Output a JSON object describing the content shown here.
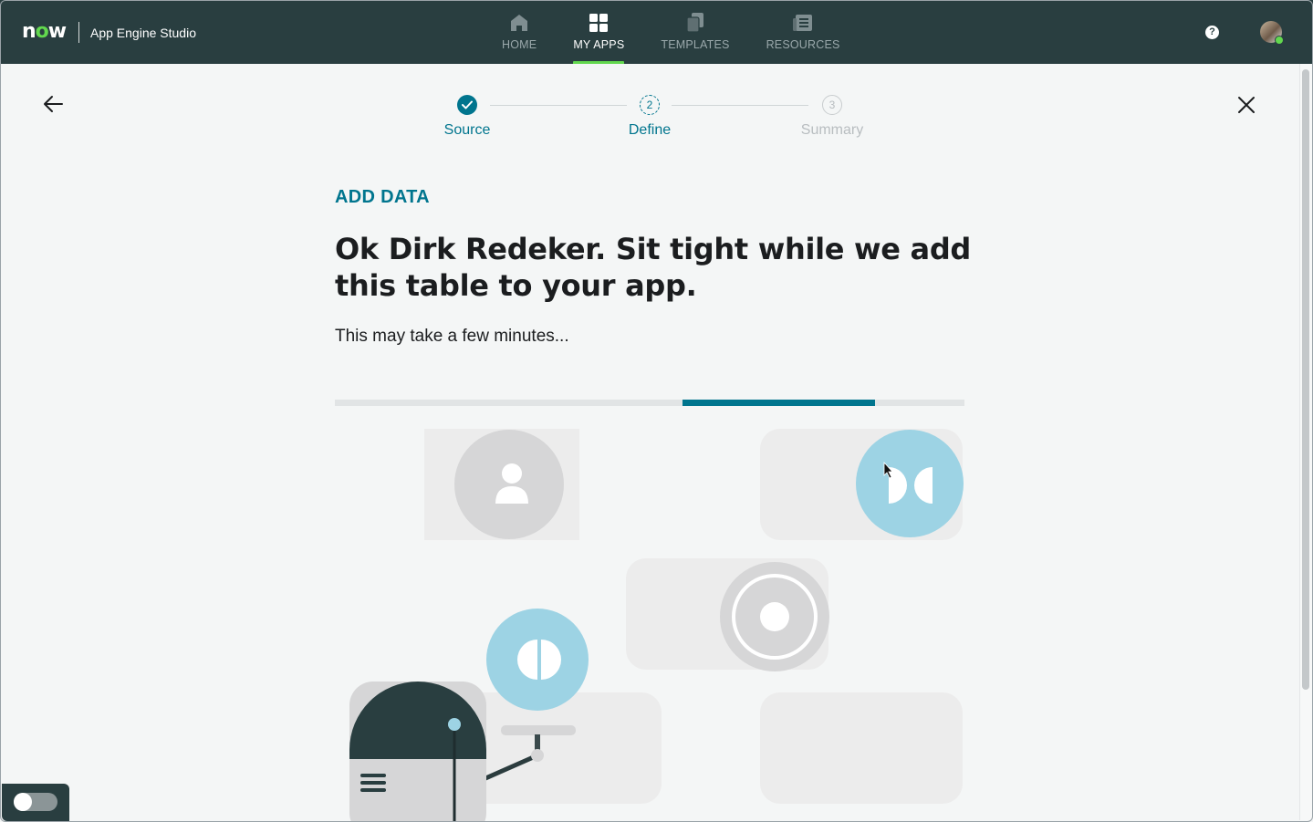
{
  "header": {
    "logo_text": "now",
    "app_title": "App Engine Studio",
    "nav": [
      {
        "label": "HOME",
        "icon": "home-icon",
        "active": false
      },
      {
        "label": "MY APPS",
        "icon": "grid-icon",
        "active": true
      },
      {
        "label": "TEMPLATES",
        "icon": "templates-icon",
        "active": false
      },
      {
        "label": "RESOURCES",
        "icon": "resources-icon",
        "active": false
      }
    ],
    "help_label": "?",
    "colors": {
      "bar": "#293e40",
      "accent": "#62d84e"
    }
  },
  "stepper": {
    "steps": [
      {
        "number": "1",
        "label": "Source",
        "state": "complete"
      },
      {
        "number": "2",
        "label": "Define",
        "state": "current"
      },
      {
        "number": "3",
        "label": "Summary",
        "state": "upcoming"
      }
    ],
    "accent": "#00758e"
  },
  "content": {
    "eyebrow": "ADD DATA",
    "headline": "Ok Dirk Redeker. Sit tight while we add this table to your app.",
    "subtext": "This may take a few minutes...",
    "progress": {
      "start_fraction": 0.552,
      "end_fraction": 0.858
    }
  }
}
